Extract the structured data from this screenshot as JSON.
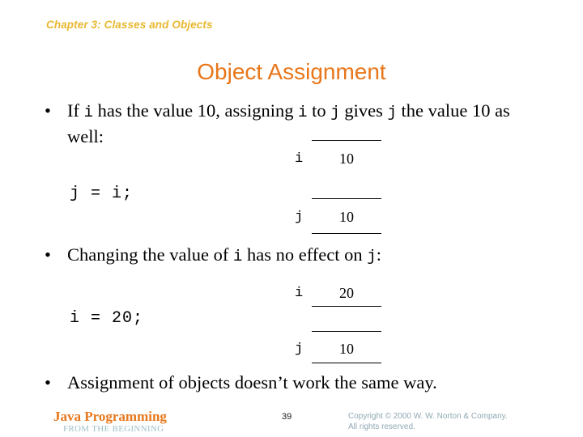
{
  "slide": {
    "chapter_header": "Chapter 3: Classes and Objects",
    "title": "Object Assignment",
    "colors": {
      "chapter_header": "#e8b830",
      "title": "#e8761a",
      "brand": "#e8761a",
      "brand_sub": "#9fc0c8",
      "copyright": "#8fa8b4",
      "body_text": "#000000",
      "background": "#ffffff"
    }
  },
  "bullets": [
    {
      "marker": "•",
      "segments": [
        {
          "text": "If ",
          "style": "serif"
        },
        {
          "text": "i",
          "style": "mono"
        },
        {
          "text": " has the value 10, assigning ",
          "style": "serif"
        },
        {
          "text": "i",
          "style": "mono"
        },
        {
          "text": " to ",
          "style": "serif"
        },
        {
          "text": "j",
          "style": "mono"
        },
        {
          "text": " gives ",
          "style": "serif"
        },
        {
          "text": "j",
          "style": "mono"
        },
        {
          "text": " the value 10 as well:",
          "style": "serif"
        }
      ],
      "plain": "If i has the value 10, assigning i to j gives j the value 10 as well:"
    },
    {
      "marker": "•",
      "segments": [
        {
          "text": "Changing the value of ",
          "style": "serif"
        },
        {
          "text": "i",
          "style": "mono"
        },
        {
          "text": " has no effect on ",
          "style": "serif"
        },
        {
          "text": "j",
          "style": "mono"
        },
        {
          "text": ":",
          "style": "serif"
        }
      ],
      "plain": "Changing the value of i has no effect on j:"
    },
    {
      "marker": "•",
      "segments": [
        {
          "text": "Assignment of objects doesn’t work the same way.",
          "style": "serif"
        }
      ],
      "plain": "Assignment of objects doesn’t work the same way."
    }
  ],
  "code_lines": [
    {
      "text": "j = i;"
    },
    {
      "text": "i = 20;"
    }
  ],
  "diagrams": [
    {
      "name": "assignment-result-diagram",
      "variables": [
        {
          "label": "i",
          "value": "10"
        },
        {
          "label": "j",
          "value": "10"
        }
      ]
    },
    {
      "name": "after-change-diagram",
      "variables": [
        {
          "label": "i",
          "value": "20"
        },
        {
          "label": "j",
          "value": "10"
        }
      ]
    }
  ],
  "footer": {
    "brand": "Java Programming",
    "brand_sub": "FROM THE BEGINNING",
    "page_number": "39",
    "copyright_line1": "Copyright © 2000 W. W. Norton & Company.",
    "copyright_line2": "All rights reserved."
  }
}
